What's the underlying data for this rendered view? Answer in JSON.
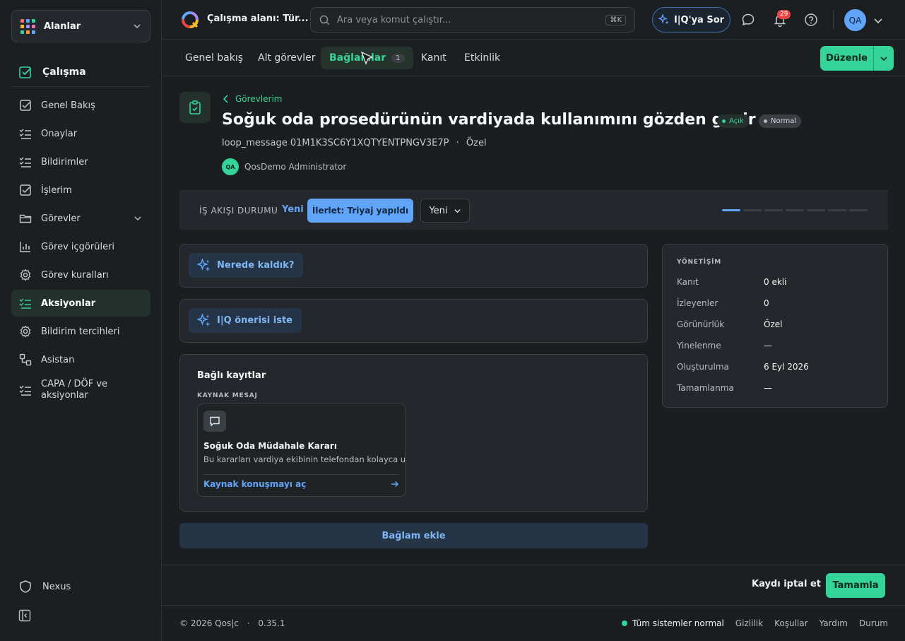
{
  "sidebar": {
    "workspace_switcher": "Alanlar",
    "section_title": "Çalışma",
    "items": [
      {
        "label": "Genel Bakış",
        "icon": "checkbox-icon"
      },
      {
        "label": "Onaylar",
        "icon": "list-check-icon"
      },
      {
        "label": "Bildirimler",
        "icon": "list-check-icon"
      },
      {
        "label": "İşlerim",
        "icon": "checkbox-icon"
      },
      {
        "label": "Görevler",
        "icon": "folder-icon"
      },
      {
        "label": "Görev içgörüleri",
        "icon": "bar-chart-icon"
      },
      {
        "label": "Görev kuralları",
        "icon": "gear-icon"
      },
      {
        "label": "Aksiyonlar",
        "icon": "list-check-icon",
        "active": true
      },
      {
        "label": "Bildirim tercihleri",
        "icon": "gear-icon"
      },
      {
        "label": "Asistan",
        "icon": "flow-icon"
      },
      {
        "label": "CAPA / DÖF ve aksiyonlar",
        "icon": "list-check-icon"
      }
    ],
    "bottom_item": "Nexus"
  },
  "topbar": {
    "workspace_title": "Çalışma alanı: Tür...",
    "search_placeholder": "Ara veya komut çalıştır...",
    "search_shortcut": "⌘K",
    "ask_button": "I|Q'ya Sor",
    "notification_count": "29",
    "user_initials": "QA"
  },
  "tabs": [
    {
      "label": "Genel bakış"
    },
    {
      "label": "Alt görevler"
    },
    {
      "label": "Bağlamlar",
      "count": "1",
      "active": true
    },
    {
      "label": "Kanıt"
    },
    {
      "label": "Etkinlik"
    }
  ],
  "edit_button": "Düzenle",
  "task": {
    "breadcrumb": "Görevlerim",
    "title": "Soğuk oda prosedürünün vardiyada kullanımını gözden geçir",
    "status_badge": "Açık",
    "priority_badge": "Normal",
    "reference": "loop_message 01M1K3SC6Y1XQTYENTPNGV3E7P",
    "separator": "·",
    "visibility": "Özel",
    "owner_initials": "QA",
    "owner_name": "QosDemo Administrator"
  },
  "workflow": {
    "label": "İŞ AKIŞI DURUMU",
    "state": "Yeni",
    "advance_button": "İlerlet: Triyaj yapıldı",
    "select_value": "Yeni",
    "steps_total": 7,
    "steps_done": 1
  },
  "ai": {
    "where_left": "Nerede kaldık?",
    "suggest": "I|Q önerisi iste"
  },
  "linked": {
    "title": "Bağlı kayıtlar",
    "source_label": "KAYNAK MESAJ",
    "source_title": "Soğuk Oda Müdahale Kararı",
    "source_desc": "Bu kararları vardiya ekibinin telefondan kolayca uyg",
    "source_link": "Kaynak konuşmayı aç"
  },
  "add_context_button": "Bağlam ekle",
  "governance": {
    "title": "YÖNETİŞİM",
    "rows": [
      {
        "key": "Kanıt",
        "value": "0 ekli"
      },
      {
        "key": "İzleyenler",
        "value": "0"
      },
      {
        "key": "Görünürlük",
        "value": "Özel"
      },
      {
        "key": "Yinelenme",
        "value": "—"
      },
      {
        "key": "Oluşturulma",
        "value": "6 Eyl 2026"
      },
      {
        "key": "Tamamlanma",
        "value": "—"
      }
    ]
  },
  "actions": {
    "cancel": "Kaydı iptal et",
    "complete": "Tamamla"
  },
  "footer": {
    "copyright": "© 2026 Qos|c",
    "dot": "·",
    "version": "0.35.1",
    "status": "Tüm sistemler normal",
    "links": [
      "Gizlilik",
      "Koşullar",
      "Yardım",
      "Durum"
    ]
  },
  "colors": {
    "accent_green": "#34d399",
    "accent_blue": "#60a5fa",
    "danger": "#ef4444"
  }
}
